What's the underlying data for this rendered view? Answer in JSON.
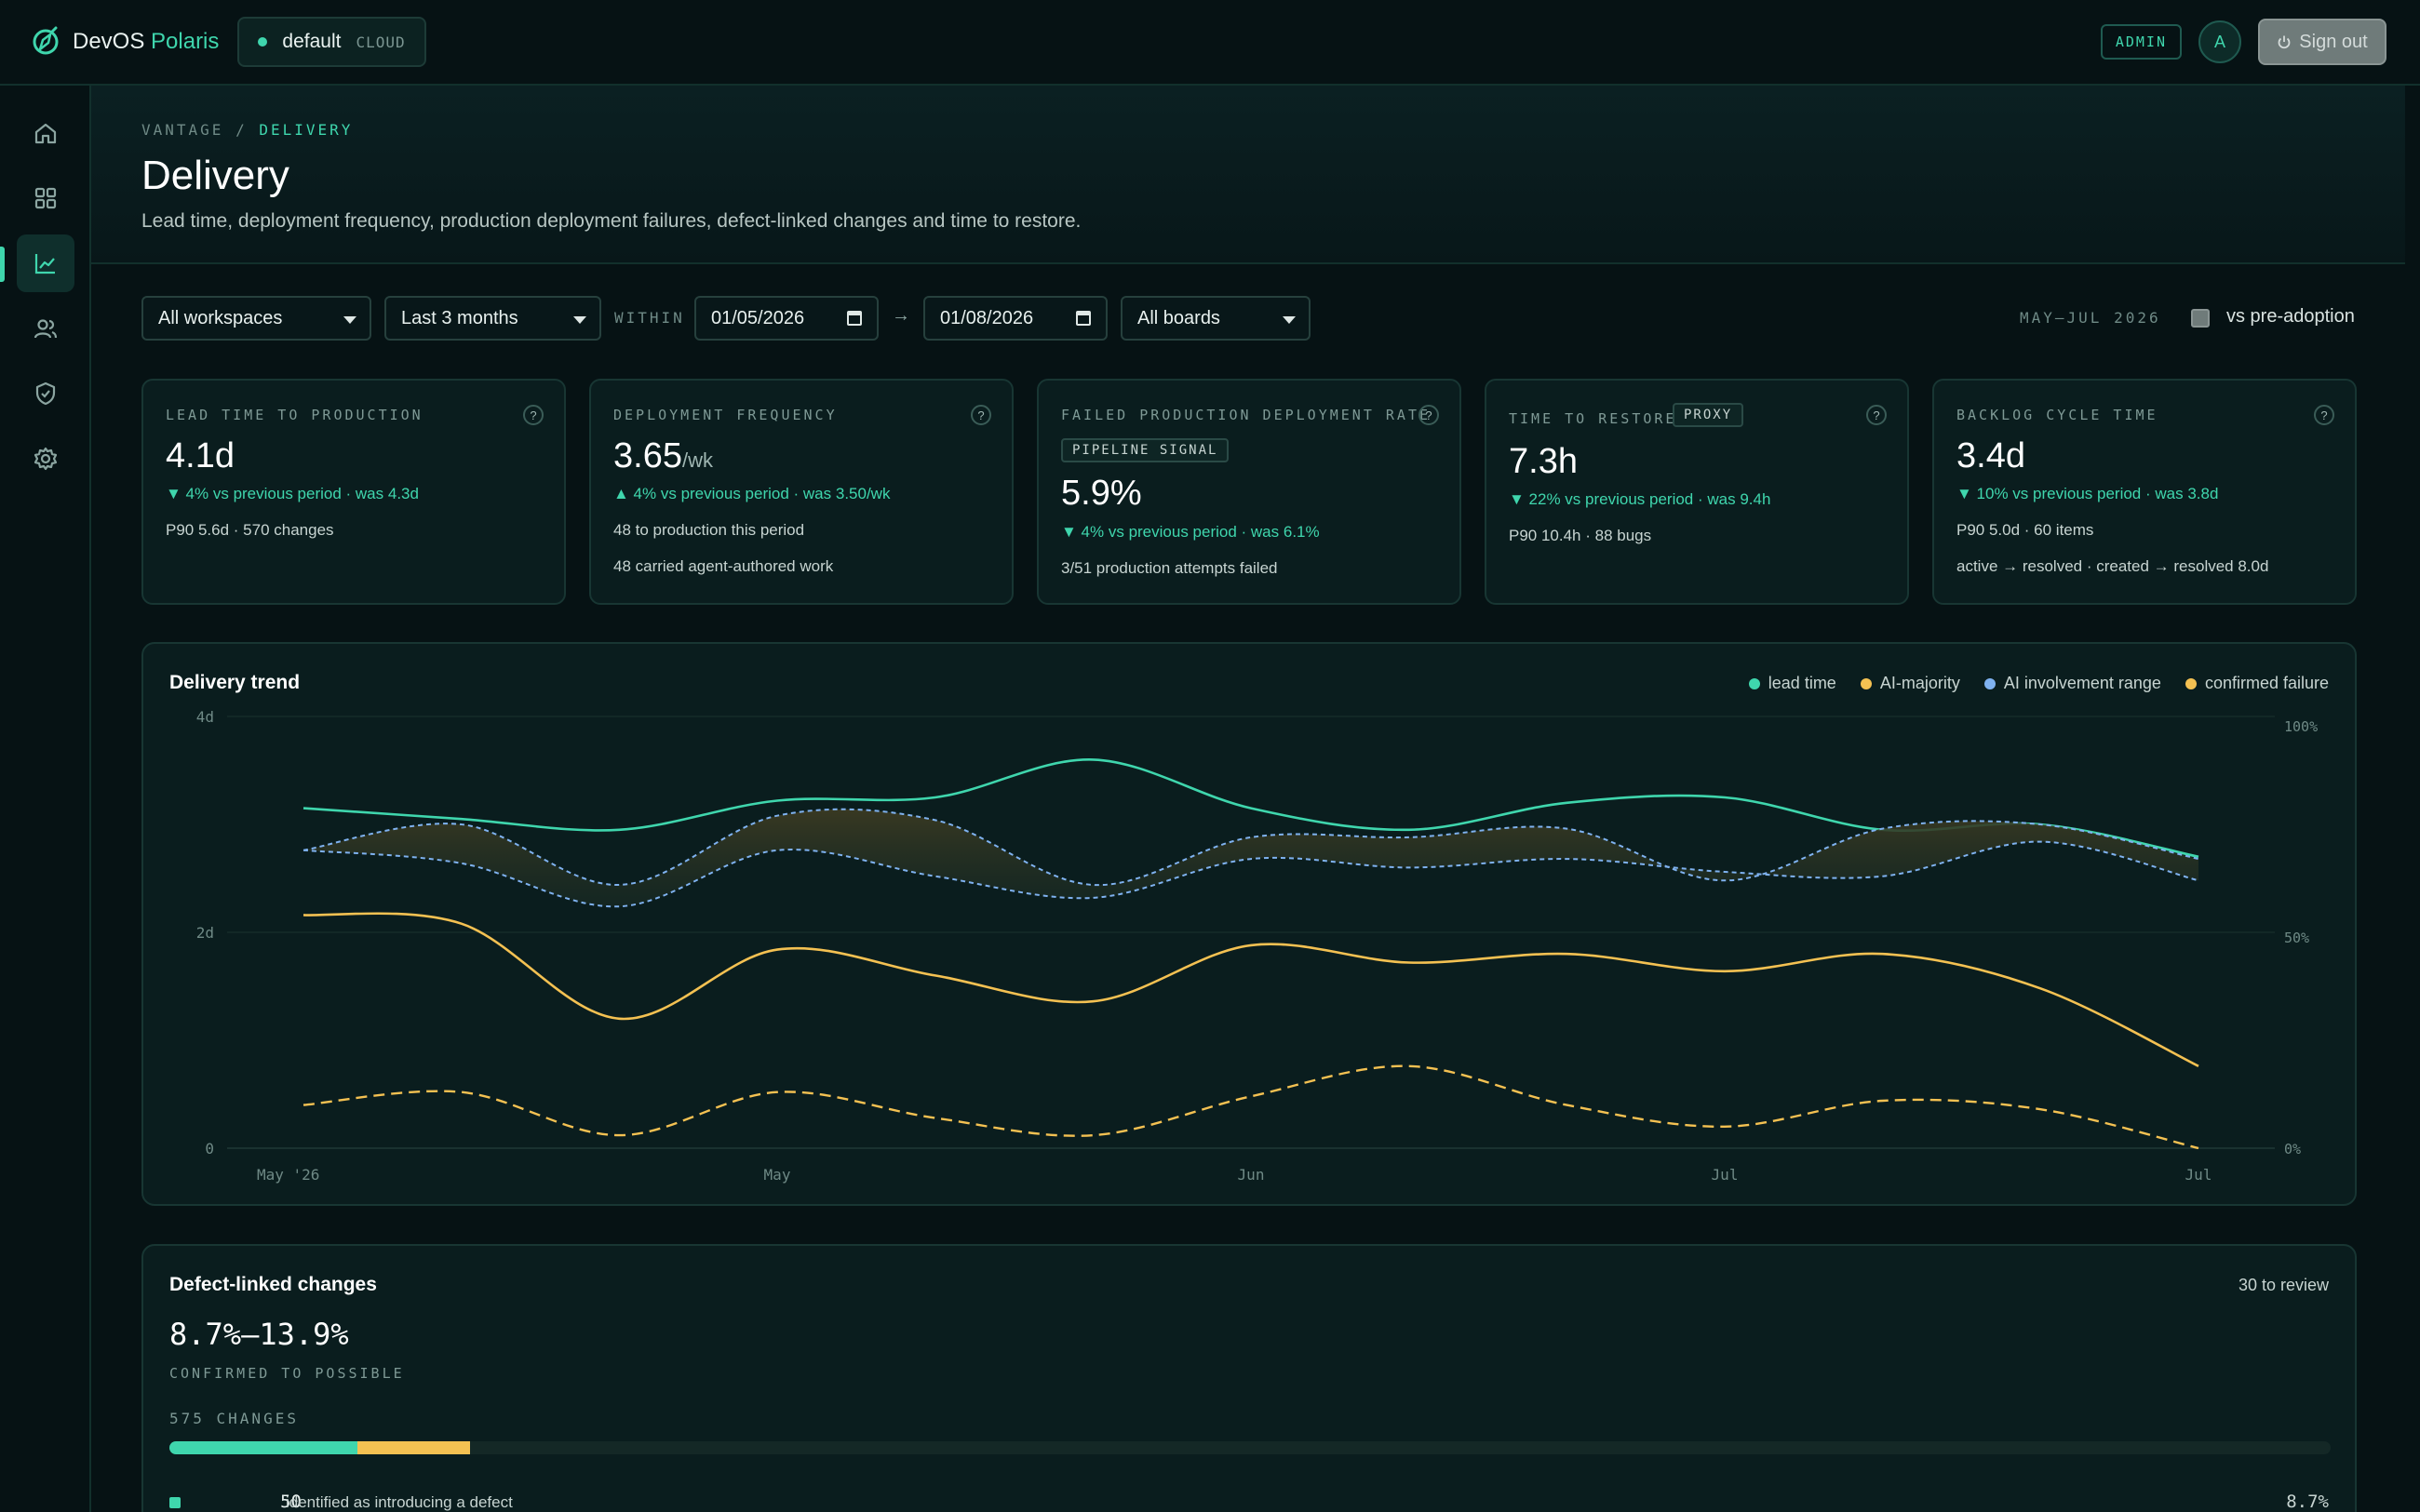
{
  "app": {
    "brand_prefix": "DevOS",
    "brand_accent": "Polaris",
    "workspace": "default",
    "workspace_env": "CLOUD",
    "role_badge": "ADMIN",
    "avatar_initial": "A",
    "signout_label": "Sign out"
  },
  "sidebar": {
    "items": [
      {
        "icon": "home-icon",
        "active": false
      },
      {
        "icon": "grid-icon",
        "active": false
      },
      {
        "icon": "chart-line-icon",
        "active": true
      },
      {
        "icon": "users-icon",
        "active": false
      },
      {
        "icon": "shield-icon",
        "active": false
      },
      {
        "icon": "gear-icon",
        "active": false
      }
    ]
  },
  "header": {
    "crumb_parent": "VANTAGE",
    "crumb_sep": "/",
    "crumb_current": "DELIVERY",
    "title": "Delivery",
    "subtitle": "Lead time, deployment frequency, production deployment failures, defect-linked changes and time to restore."
  },
  "filters": {
    "workspace": "All workspaces",
    "period": "Last 3 months",
    "within_label": "WITHIN",
    "date_from": "01/05/2026",
    "arrow": "→",
    "date_to": "01/08/2026",
    "boards": "All boards",
    "range_label": "MAY–JUL 2026",
    "compare_label": "vs pre-adoption",
    "compare_checked": false
  },
  "kpis": [
    {
      "label": "LEAD TIME TO PRODUCTION",
      "value": "4.1d",
      "unit": "",
      "tag": "",
      "delta": "▼ 4% vs previous period · was 4.3d",
      "lines": [
        "P90 5.6d · 570 changes"
      ]
    },
    {
      "label": "DEPLOYMENT FREQUENCY",
      "value": "3.65",
      "unit": "/wk",
      "tag": "",
      "delta": "▲ 4% vs previous period · was 3.50/wk",
      "lines": [
        "48 to production this period",
        "48 carried agent-authored work"
      ]
    },
    {
      "label": "FAILED PRODUCTION DEPLOYMENT RATE",
      "value": "5.9%",
      "unit": "",
      "tag": "PIPELINE SIGNAL",
      "delta": "▼ 4% vs previous period · was 6.1%",
      "lines": [
        "3/51 production attempts failed"
      ]
    },
    {
      "label": "TIME TO RESTORE",
      "value": "7.3h",
      "unit": "",
      "tag": "PROXY",
      "delta": "▼ 22% vs previous period · was 9.4h",
      "lines": [
        "P90 10.4h · 88 bugs"
      ]
    },
    {
      "label": "BACKLOG CYCLE TIME",
      "value": "3.4d",
      "unit": "",
      "tag": "",
      "delta": "▼ 10% vs previous period · was 3.8d",
      "lines": [
        "P90 5.0d · 60 items",
        "active → resolved · created → resolved 8.0d"
      ]
    }
  ],
  "help_glyph": "?",
  "trend": {
    "title": "Delivery trend",
    "legend": [
      {
        "label": "lead time",
        "color": "#3fd6ad"
      },
      {
        "label": "AI-majority",
        "color": "#f4c152"
      },
      {
        "label": "AI involvement range",
        "color": "#7fb2f0"
      },
      {
        "label": "confirmed failure",
        "color": "#f4c152"
      }
    ]
  },
  "chart_data": {
    "type": "line",
    "title": "Delivery trend",
    "x": [
      "May '26",
      "",
      "",
      "May",
      "",
      "",
      "Jun",
      "",
      "",
      "Jul",
      "",
      "",
      "Jul"
    ],
    "x_ticks": [
      "May '26",
      "May",
      "Jun",
      "Jul",
      "Jul"
    ],
    "y_left_ticks": [
      "4d",
      "2d",
      "0"
    ],
    "y_right_ticks": [
      "100%",
      "50%",
      "0%"
    ],
    "y_left_range": [
      0,
      4
    ],
    "y_right_range": [
      0,
      100
    ],
    "series": [
      {
        "name": "lead time",
        "axis": "left",
        "color": "#3fd6ad",
        "style": "solid",
        "values": [
          3.15,
          3.05,
          2.95,
          3.22,
          3.25,
          3.6,
          3.15,
          2.95,
          3.2,
          3.25,
          2.95,
          3.0,
          2.7
        ]
      },
      {
        "name": "AI involvement range",
        "axis": "right",
        "color": "#7fb2f0",
        "style": "band",
        "upper": [
          69,
          75,
          61,
          77,
          76,
          61,
          72,
          72,
          74,
          62,
          74,
          75,
          67
        ],
        "lower": [
          69,
          66,
          56,
          69,
          63,
          58,
          67,
          65,
          67,
          64,
          63,
          71,
          62
        ]
      },
      {
        "name": "AI-majority",
        "axis": "right",
        "color": "#f4c152",
        "style": "solid",
        "values": [
          54,
          52,
          30,
          46,
          40,
          34,
          47,
          43,
          45,
          41,
          45,
          37,
          19
        ]
      },
      {
        "name": "confirmed failure",
        "axis": "right",
        "color": "#f4c152",
        "style": "dashed",
        "values": [
          10,
          13,
          3,
          13,
          7,
          3,
          12,
          19,
          10,
          5,
          11,
          9,
          0
        ]
      }
    ]
  },
  "defects": {
    "title": "Defect-linked changes",
    "review": "30 to review",
    "range": "8.7%–13.9%",
    "caption": "CONFIRMED TO POSSIBLE",
    "changes": "575 CHANGES",
    "bar": [
      {
        "label": "confirmed",
        "fraction": 0.087,
        "color": "#3fd6ad"
      },
      {
        "label": "possible",
        "fraction": 0.052,
        "color": "#f4c152"
      }
    ],
    "row": {
      "count": "50",
      "text": "identified as introducing a defect",
      "pct": "8.7%"
    }
  }
}
